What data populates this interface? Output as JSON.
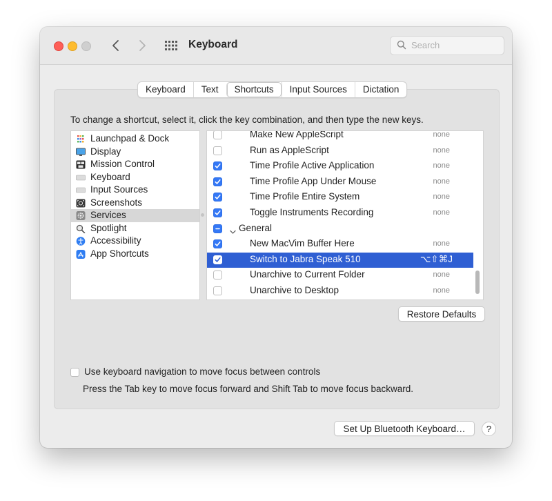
{
  "window": {
    "title": "Keyboard",
    "search_placeholder": "Search"
  },
  "tabs": [
    {
      "label": "Keyboard",
      "active": false
    },
    {
      "label": "Text",
      "active": false
    },
    {
      "label": "Shortcuts",
      "active": true
    },
    {
      "label": "Input Sources",
      "active": false
    },
    {
      "label": "Dictation",
      "active": false
    }
  ],
  "instruction": "To change a shortcut, select it, click the key combination, and then type the new keys.",
  "categories": [
    {
      "label": "Launchpad & Dock",
      "icon": "launchpad-icon"
    },
    {
      "label": "Display",
      "icon": "display-icon"
    },
    {
      "label": "Mission Control",
      "icon": "mission-control-icon"
    },
    {
      "label": "Keyboard",
      "icon": "keyboard-icon"
    },
    {
      "label": "Input Sources",
      "icon": "input-sources-icon"
    },
    {
      "label": "Screenshots",
      "icon": "screenshot-icon"
    },
    {
      "label": "Services",
      "icon": "gear-icon",
      "selected": true
    },
    {
      "label": "Spotlight",
      "icon": "magnifier-icon"
    },
    {
      "label": "Accessibility",
      "icon": "accessibility-icon"
    },
    {
      "label": "App Shortcuts",
      "icon": "app-store-icon"
    }
  ],
  "services": [
    {
      "label": "Make New AppleScript",
      "checked": false,
      "shortcut": "none"
    },
    {
      "label": "Run as AppleScript",
      "checked": false,
      "shortcut": "none"
    },
    {
      "label": "Time Profile Active Application",
      "checked": true,
      "shortcut": "none"
    },
    {
      "label": "Time Profile App Under Mouse",
      "checked": true,
      "shortcut": "none"
    },
    {
      "label": "Time Profile Entire System",
      "checked": true,
      "shortcut": "none"
    },
    {
      "label": "Toggle Instruments Recording",
      "checked": true,
      "shortcut": "none"
    },
    {
      "label": "General",
      "group": true,
      "state": "mixed",
      "shortcut": ""
    },
    {
      "label": "New MacVim Buffer Here",
      "checked": true,
      "shortcut": "none"
    },
    {
      "label": "Switch to Jabra Speak 510",
      "checked": true,
      "shortcut": "⌥⇧⌘J",
      "selected": true
    },
    {
      "label": "Unarchive to Current Folder",
      "checked": false,
      "shortcut": "none"
    },
    {
      "label": "Unarchive to Desktop",
      "checked": false,
      "shortcut": "none"
    }
  ],
  "buttons": {
    "restore_defaults": "Restore Defaults",
    "bluetooth": "Set Up Bluetooth Keyboard…",
    "help": "?"
  },
  "keyboard_nav": {
    "label": "Use keyboard navigation to move focus between controls",
    "checked": false,
    "hint": "Press the Tab key to move focus forward and Shift Tab to move focus backward."
  },
  "colors": {
    "selection": "#2f5fd3",
    "checkbox_on": "#3478f6",
    "close": "#fe5f57",
    "minimize": "#febc2e"
  }
}
